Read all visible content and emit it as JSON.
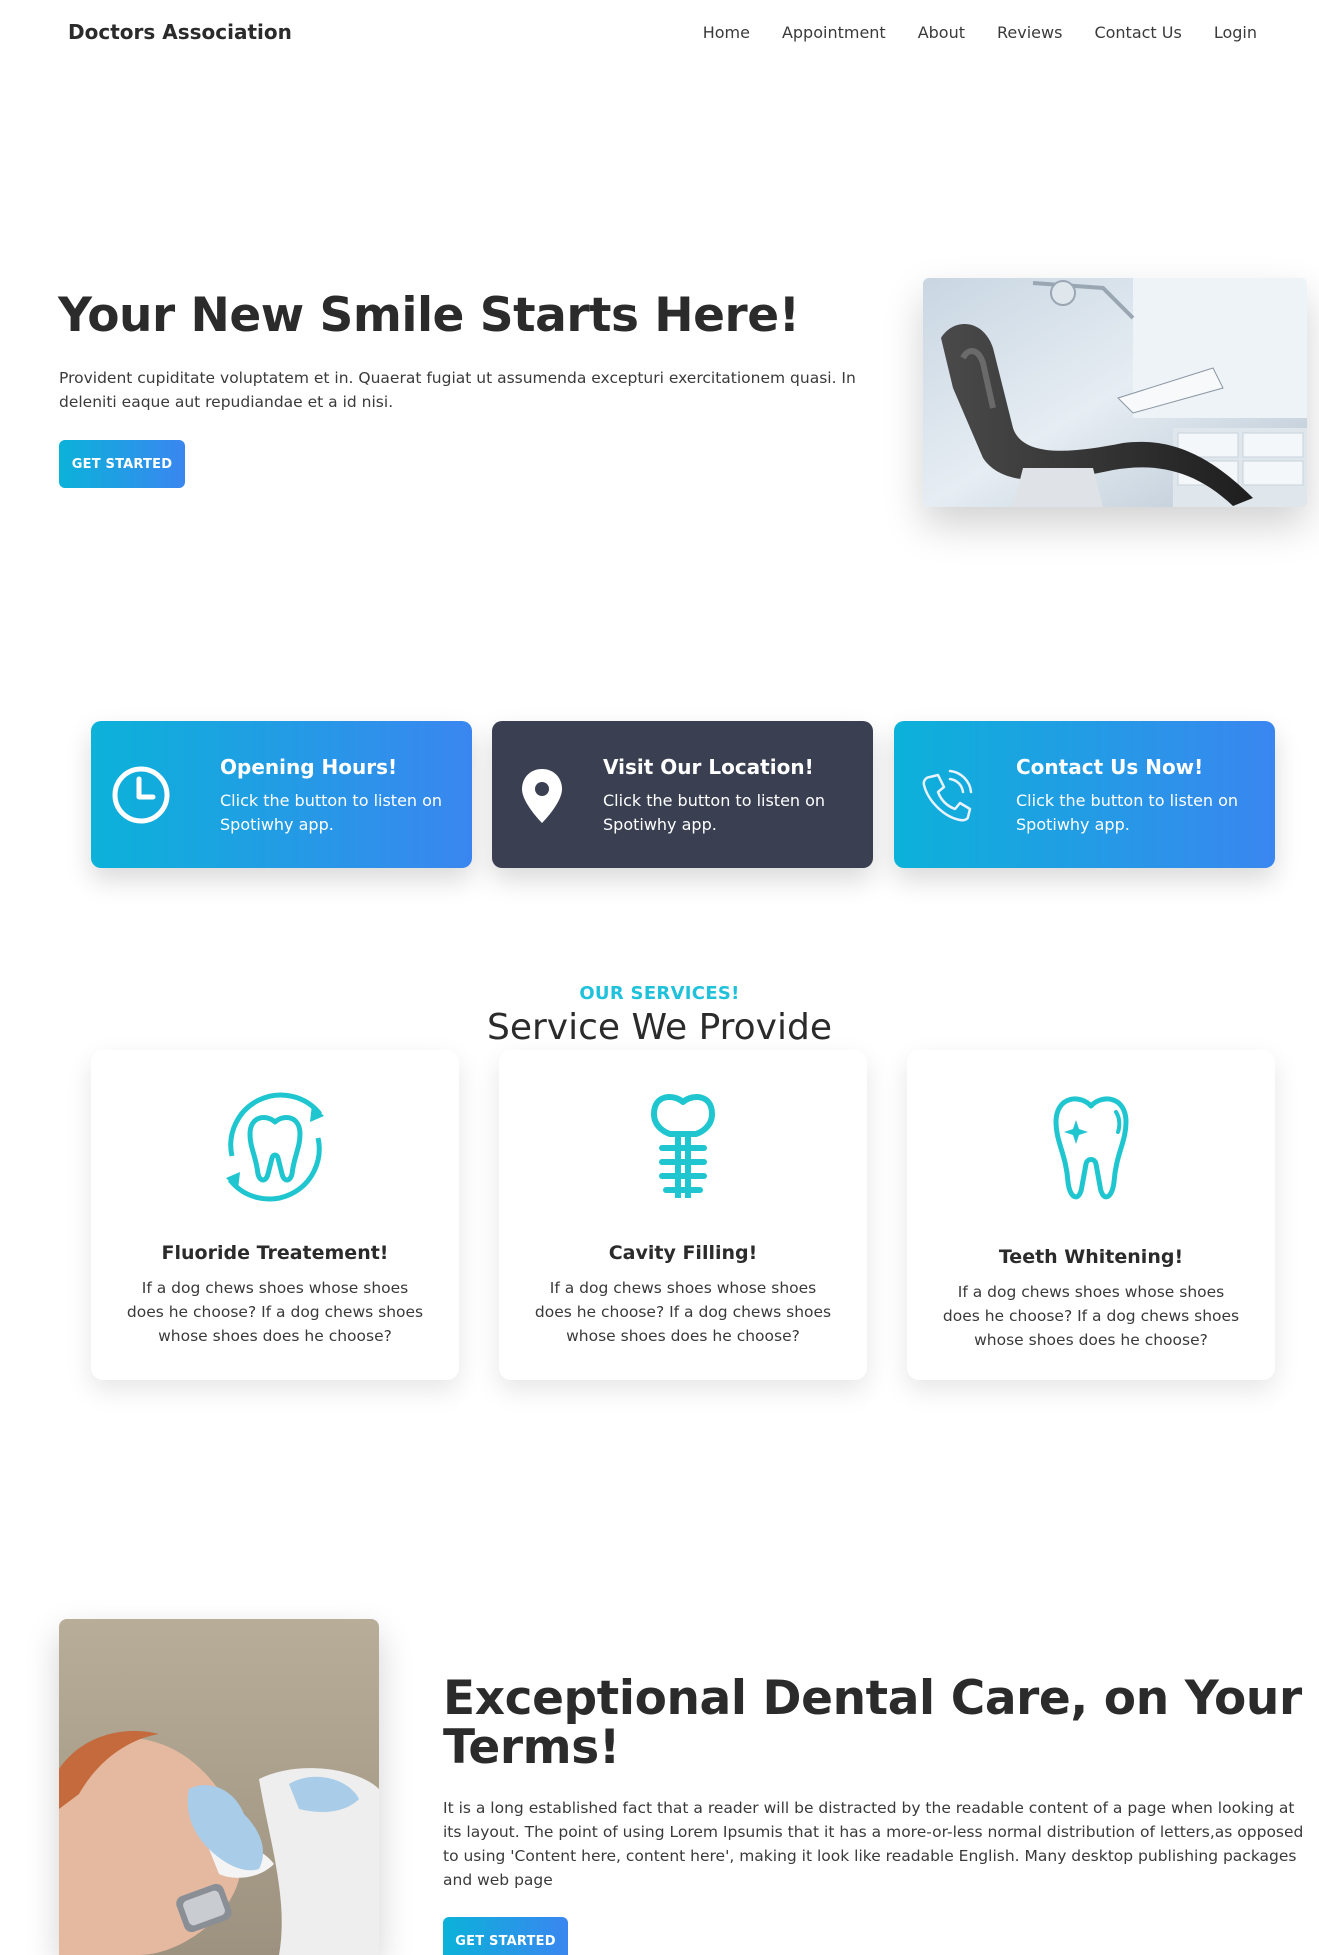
{
  "nav": {
    "brand": "Doctors Association",
    "links": [
      "Home",
      "Appointment",
      "About",
      "Reviews",
      "Contact Us",
      "Login"
    ]
  },
  "hero": {
    "title": "Your New Smile Starts Here!",
    "text": "Provident cupiditate voluptatem et in. Quaerat fugiat ut assumenda excepturi exercitationem quasi. In deleniti eaque aut repudiandae et a id nisi.",
    "button": "GET STARTED"
  },
  "info_cards": [
    {
      "icon": "clock-icon",
      "title": "Opening Hours!",
      "text": "Click the button to listen on Spotiwhy app."
    },
    {
      "icon": "location-pin-icon",
      "title": "Visit Our Location!",
      "text": "Click the button to listen on Spotiwhy app."
    },
    {
      "icon": "phone-icon",
      "title": "Contact Us Now!",
      "text": "Click the button to listen on Spotiwhy app."
    }
  ],
  "services": {
    "eyebrow": "OUR SERVICES!",
    "title": "Service We Provide",
    "items": [
      {
        "icon": "tooth-cycle-icon",
        "title": "Fluoride Treatement!",
        "text": "If a dog chews shoes whose shoes does he choose? If a dog chews shoes whose shoes does he choose?"
      },
      {
        "icon": "dental-implant-icon",
        "title": "Cavity Filling!",
        "text": "If a dog chews shoes whose shoes does he choose? If a dog chews shoes whose shoes does he choose?"
      },
      {
        "icon": "tooth-sparkle-icon",
        "title": "Teeth Whitening!",
        "text": "If a dog chews shoes whose shoes does he choose? If a dog chews shoes whose shoes does he choose?"
      }
    ]
  },
  "about": {
    "title": "Exceptional Dental Care, on Your Terms!",
    "text": "It is a long established fact that a reader will be distracted by the readable content of a page when looking at its layout. The point of using Lorem Ipsumis that it has a more-or-less normal distribution of letters,as opposed to using 'Content here, content here', making it look like readable English. Many desktop publishing packages and web page",
    "button": "GET STARTED"
  },
  "colors": {
    "accent_start": "#0bb2d9",
    "accent_end": "#3a86f0",
    "dark_card": "#3a4052",
    "service_icon": "#1fc6cf",
    "text": "#2b2b2b"
  }
}
